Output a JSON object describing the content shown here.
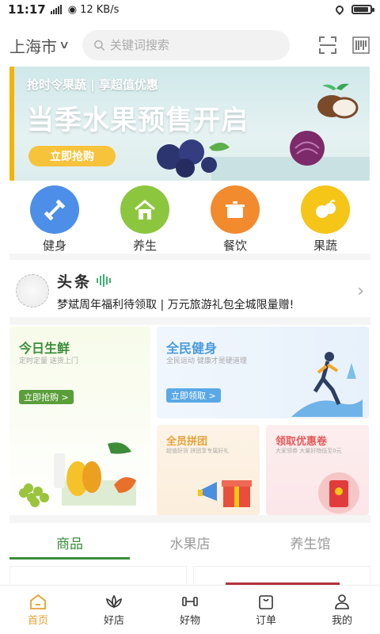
{
  "status_bar": {
    "time": "11:17",
    "network": "4G",
    "speed": "12 KB/s",
    "battery_level": 0.9
  },
  "header": {
    "city": "上海市",
    "search_placeholder": "关键词搜索",
    "icons": [
      "scan-icon",
      "barcode-icon"
    ]
  },
  "banner": {
    "subtitle": "抢时令果蔬 | 享超值优惠",
    "title": "当季水果预售开启",
    "cta": "立即抢购",
    "accent": "#f7c33a"
  },
  "categories": [
    {
      "label": "健身",
      "icon": "dumbbell-icon",
      "color": "#4c8ee8"
    },
    {
      "label": "养生",
      "icon": "house-icon",
      "color": "#8cc63f"
    },
    {
      "label": "餐饮",
      "icon": "pot-icon",
      "color": "#f28a2e"
    },
    {
      "label": "果蔬",
      "icon": "fruit-icon",
      "color": "#f5c518"
    }
  ],
  "headline": {
    "brand": "头条",
    "text": "梦斌周年福利待领取 | 万元旅游礼包全城限量赠!"
  },
  "promos": {
    "fresh": {
      "title": "今日生鲜",
      "subtitle": "定时定量 送货上门",
      "button": "立即抢购 >"
    },
    "fitness": {
      "title": "全民健身",
      "subtitle": "全民运动 健康才是硬道理",
      "button": "立即领取 >"
    },
    "group": {
      "title": "全员拼团",
      "subtitle": "超值好货 拼团享专属好礼"
    },
    "coupon": {
      "title": "领取优惠卷",
      "subtitle": "大家领券 大量好物低至0元"
    }
  },
  "tabs": [
    {
      "label": "商品",
      "active": true
    },
    {
      "label": "水果店",
      "active": false
    },
    {
      "label": "养生馆",
      "active": false
    }
  ],
  "nav": [
    {
      "label": "首页",
      "icon": "home-icon",
      "active": true
    },
    {
      "label": "好店",
      "icon": "lotus-icon",
      "active": false
    },
    {
      "label": "好物",
      "icon": "dumbbell-icon",
      "active": false
    },
    {
      "label": "订单",
      "icon": "bag-icon",
      "active": false
    },
    {
      "label": "我的",
      "icon": "user-icon",
      "active": false
    }
  ]
}
